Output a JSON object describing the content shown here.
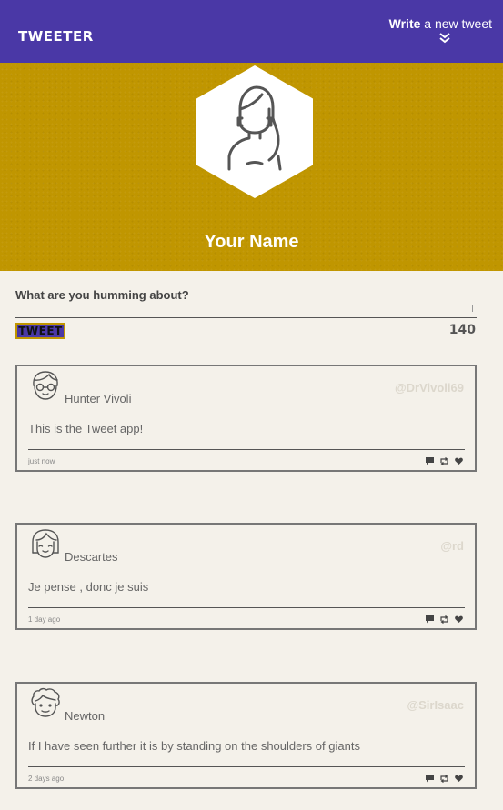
{
  "nav": {
    "brand": "TWEETER",
    "write_bold": "Write",
    "write_rest": "a new tweet"
  },
  "profile": {
    "name": "Your Name"
  },
  "compose": {
    "label": "What are you humming about?",
    "value": "",
    "button_label": "TWEET",
    "counter": "140"
  },
  "tweets": [
    {
      "name": "Hunter Vivoli",
      "handle": "@DrVivoli69",
      "text": "This is the Tweet app!",
      "time": "just now",
      "avatar_icon": "man-glasses-icon"
    },
    {
      "name": "Descartes",
      "handle": "@rd",
      "text": "Je pense , donc je suis",
      "time": "1 day ago",
      "avatar_icon": "woman-bob-icon"
    },
    {
      "name": "Newton",
      "handle": "@SirIsaac",
      "text": "If I have seen further it is by standing on the shoulders of giants",
      "time": "2 days ago",
      "avatar_icon": "man-curly-hair-icon"
    }
  ],
  "colors": {
    "nav_bg": "#4a38a6",
    "hero_bg": "#c09600",
    "page_bg": "#f4f1ea"
  }
}
